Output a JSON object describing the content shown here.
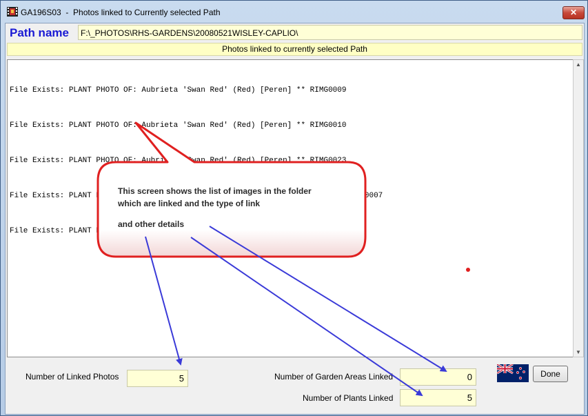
{
  "window": {
    "title": "GA196S03  -  Photos linked to Currently selected Path",
    "close_label": "✕"
  },
  "path": {
    "label": "Path name",
    "value": "F:\\_PHOTOS\\RHS-GARDENS\\20080521WISLEY-CAPLIO\\"
  },
  "list": {
    "header": "Photos linked to currently selected Path",
    "lines": [
      "File Exists: PLANT PHOTO OF: Aubrieta 'Swan Red' (Red) [Peren] ** RIMG0009",
      "File Exists: PLANT PHOTO OF: Aubrieta 'Swan Red' (Red) [Peren] ** RIMG0010",
      "File Exists: PLANT PHOTO OF: Aubrieta 'Swan Red' (Red) [Peren] ** RIMG0023",
      "File Exists: PLANT PHOTO OF: Aubrieta deltoidea 'Harknoll Red' [Peren] ** RIMG0007",
      "File Exists: PLANT PHOTO OF: Osteospermum 'Weetwood' [Peren] ** RIMG0008"
    ]
  },
  "callout": {
    "line1": "This screen shows the list of images in the folder",
    "line2": "which are linked and the type of link",
    "line3": "and other details"
  },
  "stats": {
    "linked_photos_label": "Number of Linked Photos",
    "linked_photos_value": "5",
    "garden_areas_label": "Number of Garden Areas Linked",
    "garden_areas_value": "0",
    "plants_label": "Number of Plants Linked",
    "plants_value": "5"
  },
  "buttons": {
    "done_label": "Done"
  },
  "icons": {
    "app": "film-icon",
    "flag": "nz-flag-icon"
  },
  "colors": {
    "accent_blue": "#1a1ad4",
    "field_yellow": "#ffffd6",
    "callout_red": "#e02020",
    "arrow_blue": "#3a3ad8"
  }
}
